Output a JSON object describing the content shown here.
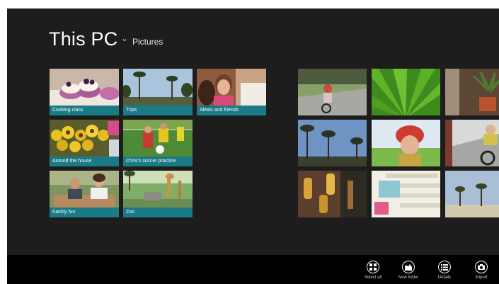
{
  "header": {
    "title": "This PC",
    "chevron": "⌄",
    "subtitle": "Pictures"
  },
  "folders": [
    {
      "label": "Cooking class"
    },
    {
      "label": "Trips"
    },
    {
      "label": "Alexis and friends"
    },
    {
      "label": "Around the house"
    },
    {
      "label": "Chris's soccer practice"
    },
    {
      "label": "Family fun"
    },
    {
      "label": "Zoo"
    }
  ],
  "appbar": {
    "commands": [
      {
        "label": "Select all",
        "icon": "select-all-icon"
      },
      {
        "label": "New folder",
        "icon": "new-folder-icon"
      },
      {
        "label": "Details",
        "icon": "details-icon"
      },
      {
        "label": "Import",
        "icon": "import-icon"
      }
    ]
  },
  "colors": {
    "background": "#1d1d1d",
    "tile_label": "#1a7b86",
    "appbar": "#000000"
  }
}
